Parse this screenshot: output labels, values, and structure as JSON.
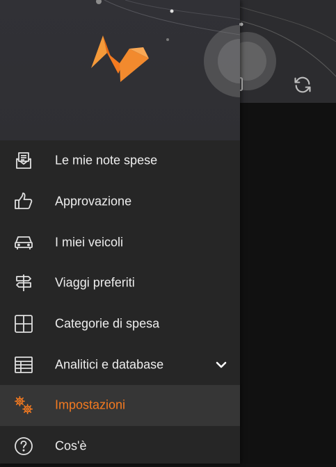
{
  "menu": {
    "items": [
      {
        "label": "Le mie note spese",
        "icon": "expense-report-icon"
      },
      {
        "label": "Approvazione",
        "icon": "thumbs-up-icon"
      },
      {
        "label": "I miei veicoli",
        "icon": "car-icon"
      },
      {
        "label": "Viaggi preferiti",
        "icon": "signpost-icon"
      },
      {
        "label": "Categorie di spesa",
        "icon": "grid-icon"
      },
      {
        "label": "Analitici e database",
        "icon": "table-icon",
        "expandable": true
      },
      {
        "label": "Impostazioni",
        "icon": "gears-icon",
        "active": true
      },
      {
        "label": "Cos'è",
        "icon": "help-circle-icon"
      }
    ]
  },
  "colors": {
    "accent": "#f47a20",
    "drawer_bg": "#262626",
    "header_bg": "#313136",
    "active_bg": "#363636"
  }
}
